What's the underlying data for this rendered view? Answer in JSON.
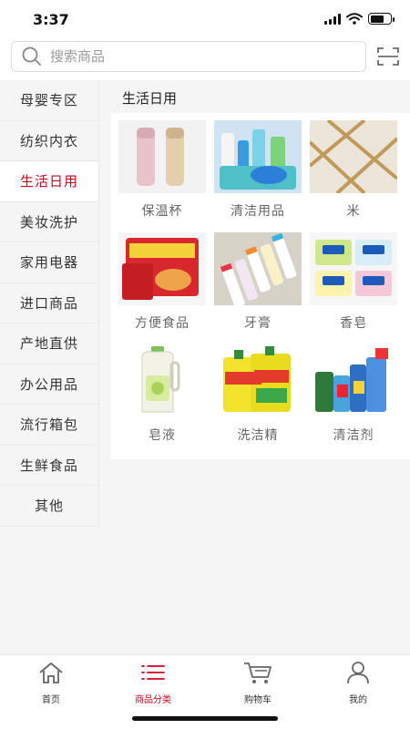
{
  "status": {
    "time": "3:37"
  },
  "search": {
    "placeholder": "搜索商品"
  },
  "sidebar": {
    "items": [
      {
        "label": "母婴专区",
        "active": false
      },
      {
        "label": "纺织内衣",
        "active": false
      },
      {
        "label": "生活日用",
        "active": true
      },
      {
        "label": "美妆洗护",
        "active": false
      },
      {
        "label": "家用电器",
        "active": false
      },
      {
        "label": "进口商品",
        "active": false
      },
      {
        "label": "产地直供",
        "active": false
      },
      {
        "label": "办公用品",
        "active": false
      },
      {
        "label": "流行箱包",
        "active": false
      },
      {
        "label": "生鲜食品",
        "active": false
      },
      {
        "label": "其他",
        "active": false
      }
    ]
  },
  "content": {
    "title": "生活日用",
    "products": [
      {
        "label": "保温杯",
        "icon": "thermos-image"
      },
      {
        "label": "清洁用品",
        "icon": "cleaning-supplies-image"
      },
      {
        "label": "米",
        "icon": "rice-image"
      },
      {
        "label": "方便食品",
        "icon": "instant-noodles-image"
      },
      {
        "label": "牙膏",
        "icon": "toothpaste-image"
      },
      {
        "label": "香皂",
        "icon": "soap-image"
      },
      {
        "label": "皂液",
        "icon": "liquid-soap-image"
      },
      {
        "label": "洗洁精",
        "icon": "dish-detergent-image"
      },
      {
        "label": "清洁剂",
        "icon": "cleaner-image"
      }
    ]
  },
  "tabbar": {
    "tabs": [
      {
        "label": "首页",
        "icon": "home-icon",
        "active": false
      },
      {
        "label": "商品分类",
        "icon": "list-icon",
        "active": true
      },
      {
        "label": "购物车",
        "icon": "cart-icon",
        "active": false
      },
      {
        "label": "我的",
        "icon": "user-icon",
        "active": false
      }
    ]
  },
  "colors": {
    "accent": "#d0021b",
    "background": "#f5f5f5"
  }
}
